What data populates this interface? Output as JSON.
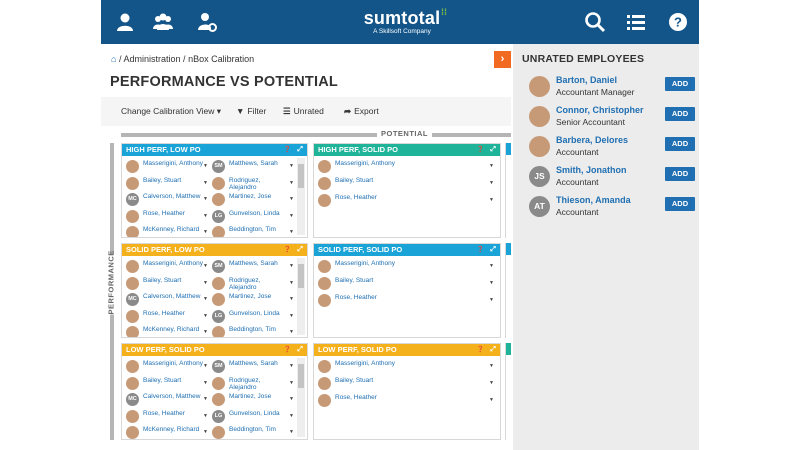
{
  "brand": {
    "name": "sumtotal",
    "tagline": "A Skillsoft Company"
  },
  "topbar": {
    "icons": [
      "user-icon",
      "users-icon",
      "user-settings-icon",
      "search-icon",
      "list-icon",
      "help-icon"
    ]
  },
  "breadcrumb": {
    "separator": "/",
    "items": [
      "Administration",
      "nBox Calibration"
    ]
  },
  "title": "PERFORMANCE VS POTENTIAL",
  "toolbar": {
    "change_view": "Change Calibration View",
    "filter": "Filter",
    "unrated": "Unrated",
    "export": "Export"
  },
  "axis": {
    "potential": "POTENTIAL",
    "performance": "PERFORMANCE"
  },
  "cells": {
    "high_low": {
      "title": "HIGH PERF, LOW PO"
    },
    "high_solid": {
      "title": "HIGH PERF, SOLID PO"
    },
    "solid_low": {
      "title": "SOLID PERF, LOW PO"
    },
    "solid_solid": {
      "title": "SOLID PERF, SOLID PO"
    },
    "low_solid": {
      "title": "LOW PERF, SOLID PO"
    },
    "low_solid2": {
      "title": "LOW PERF, SOLID PO"
    }
  },
  "grid_people": {
    "left_col": [
      {
        "name": "Masserigini, Anthony",
        "initials": ""
      },
      {
        "name": "Bailey, Stuart",
        "initials": ""
      },
      {
        "name": "Calverson, Matthew",
        "initials": "MC"
      },
      {
        "name": "Rose, Heather",
        "initials": ""
      },
      {
        "name": "McKenney, Richard",
        "initials": ""
      }
    ],
    "right_col": [
      {
        "name": "Matthews, Sarah",
        "initials": "SM"
      },
      {
        "name": "Rodriguez, Alejandro",
        "initials": ""
      },
      {
        "name": "Martinez, Jose",
        "initials": ""
      },
      {
        "name": "Gunvelson, Linda",
        "initials": "LG"
      },
      {
        "name": "Beddington, Tim",
        "initials": ""
      }
    ],
    "mid_col": [
      {
        "name": "Masserigini, Anthony"
      },
      {
        "name": "Bailey, Stuart"
      },
      {
        "name": "Rose, Heather"
      }
    ]
  },
  "unrated": {
    "title": "UNRATED EMPLOYEES",
    "add_label": "ADD",
    "employees": [
      {
        "name": "Barton, Daniel",
        "role": "Accountant Manager",
        "initials": ""
      },
      {
        "name": "Connor, Christopher",
        "role": "Senior Accountant",
        "initials": ""
      },
      {
        "name": "Barbera, Delores",
        "role": "Accountant",
        "initials": ""
      },
      {
        "name": "Smith, Jonathon",
        "role": "Accountant",
        "initials": "JS"
      },
      {
        "name": "Thieson, Amanda",
        "role": "Accountant",
        "initials": "AT"
      }
    ]
  },
  "colors": {
    "header": "#135589",
    "accent": "#1f6fb2",
    "orange": "#f26a21",
    "blue_cell": "#19a3d6",
    "teal_cell": "#1fb39a",
    "yellow_cell": "#f5b11c"
  }
}
